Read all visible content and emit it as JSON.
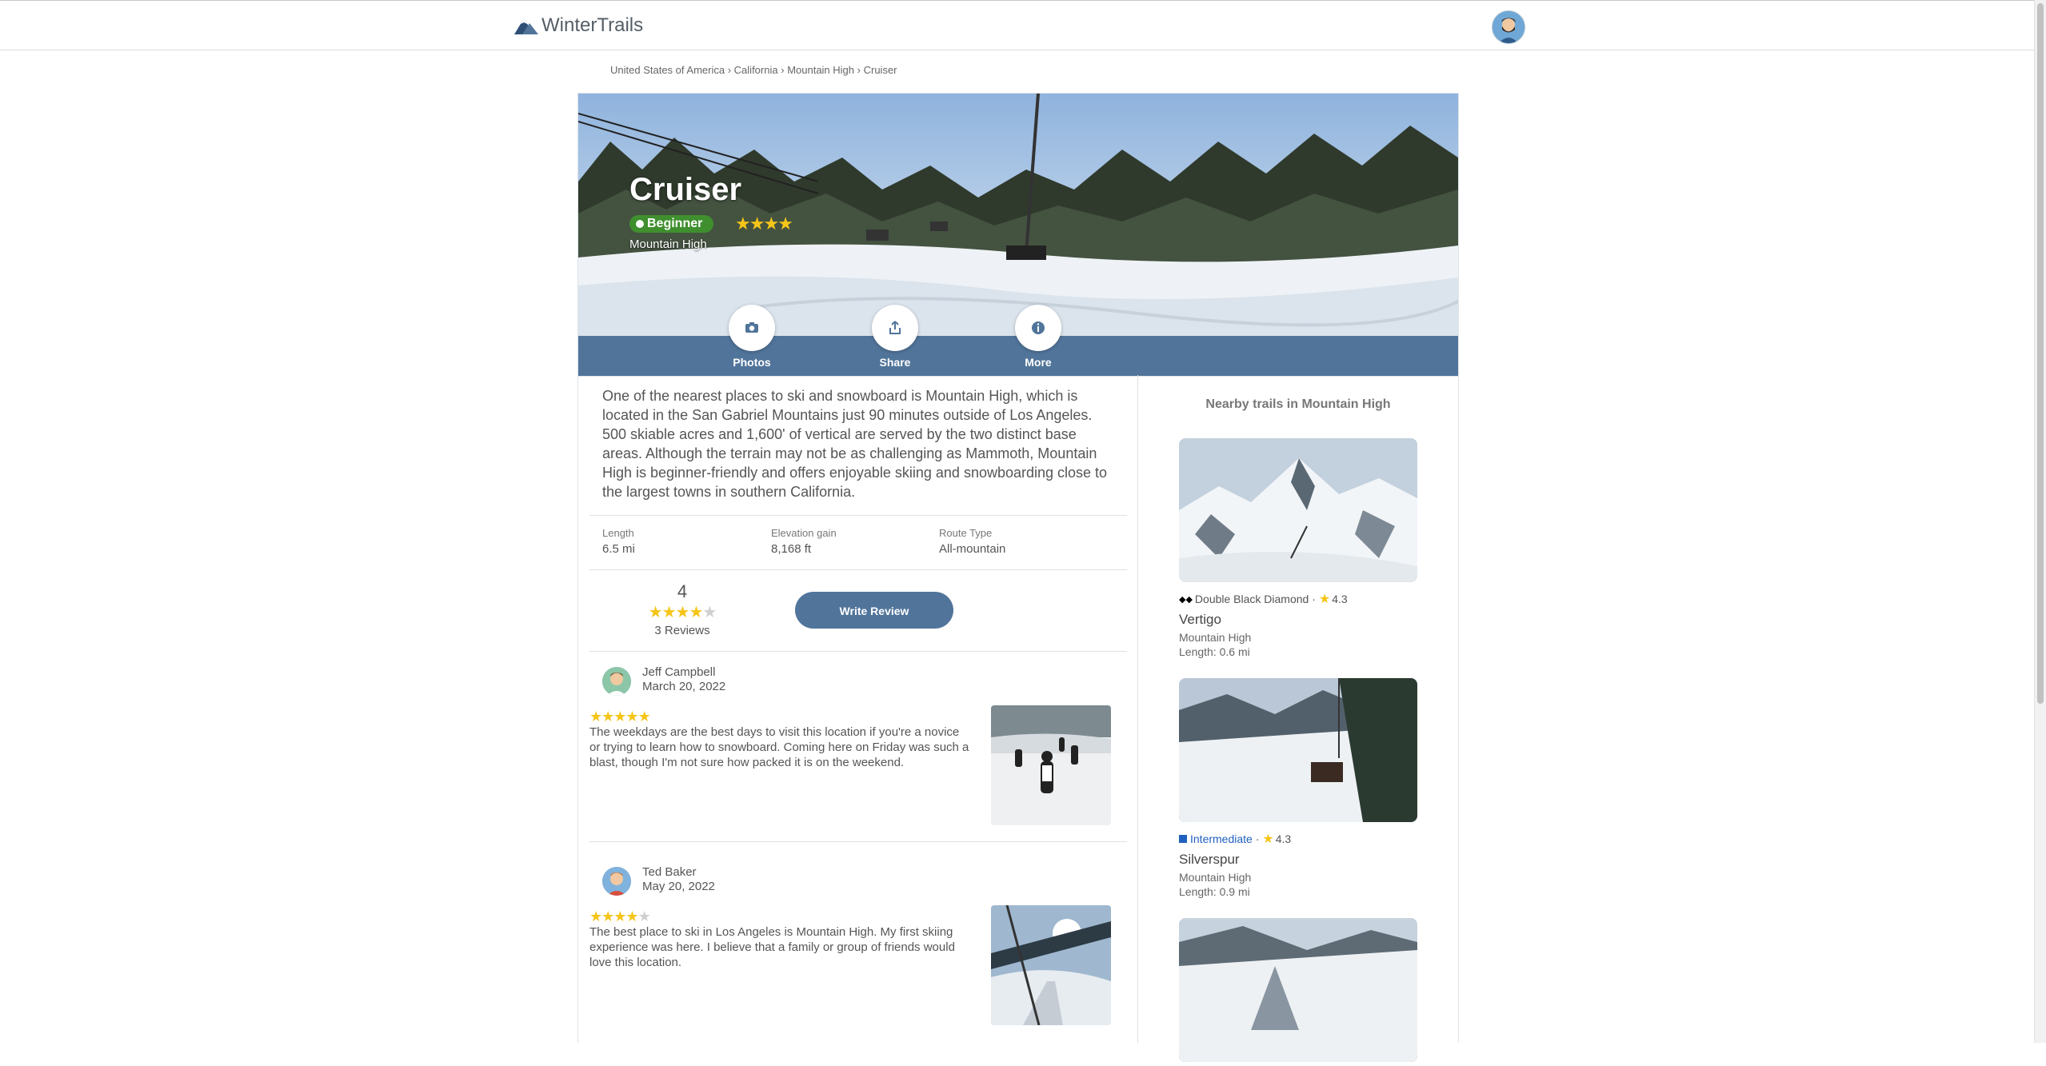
{
  "app": {
    "logo_text": "WinterTrails",
    "accent_color": "#51749a"
  },
  "breadcrumb": [
    "United States of America",
    "California",
    "Mountain High",
    "Cruiser"
  ],
  "breadcrumb_separator": "›",
  "trail": {
    "name": "Cruiser",
    "difficulty": "Beginner",
    "difficulty_color": "#3f8f2f",
    "rating_stars": 4,
    "resort": "Mountain High",
    "description": "One of the nearest places to ski and snowboard is Mountain High, which is located in the San Gabriel Mountains just 90 minutes outside of Los Angeles. 500 skiable acres and 1,600' of vertical are served by the two distinct base areas. Although the terrain may not be as challenging as Mammoth, Mountain High is beginner-friendly and offers enjoyable skiing and snowboarding close to the largest towns in southern California."
  },
  "actions": [
    {
      "label": "Photos",
      "icon": "camera-icon"
    },
    {
      "label": "Share",
      "icon": "share-icon"
    },
    {
      "label": "More",
      "icon": "info-icon"
    }
  ],
  "stats": [
    {
      "label": "Length",
      "value": "6.5 mi"
    },
    {
      "label": "Elevation gain",
      "value": "8,168 ft"
    },
    {
      "label": "Route Type",
      "value": "All-mountain"
    }
  ],
  "rating_summary": {
    "average": "4",
    "stars": 4,
    "count_label": "3 Reviews",
    "write_review_label": "Write Review"
  },
  "reviews": [
    {
      "name": "Jeff Campbell",
      "date": "March 20, 2022",
      "stars": 5,
      "text": "The weekdays are the best days to visit this location if you're a novice or trying to learn how to snowboard. Coming here on Friday was such a blast, though I'm not sure how packed it is on the weekend."
    },
    {
      "name": "Ted Baker",
      "date": "May 20, 2022",
      "stars": 4,
      "text": "The best place to ski in Los Angeles is Mountain High. My first skiing experience was here. I believe that a family or group of friends would love this location."
    }
  ],
  "nearby": {
    "heading": "Nearby trails in Mountain High",
    "trails": [
      {
        "difficulty": "Double Black Diamond",
        "difficulty_icon": "double-diamond-icon",
        "rating": "4.3",
        "name": "Vertigo",
        "resort": "Mountain High",
        "length": "Length: 0.6 mi"
      },
      {
        "difficulty": "Intermediate",
        "difficulty_icon": "blue-square-icon",
        "rating": "4.3",
        "name": "Silverspur",
        "resort": "Mountain High",
        "length": "Length: 0.9 mi"
      },
      {
        "difficulty": "",
        "rating": "",
        "name": "",
        "resort": "",
        "length": ""
      }
    ]
  }
}
